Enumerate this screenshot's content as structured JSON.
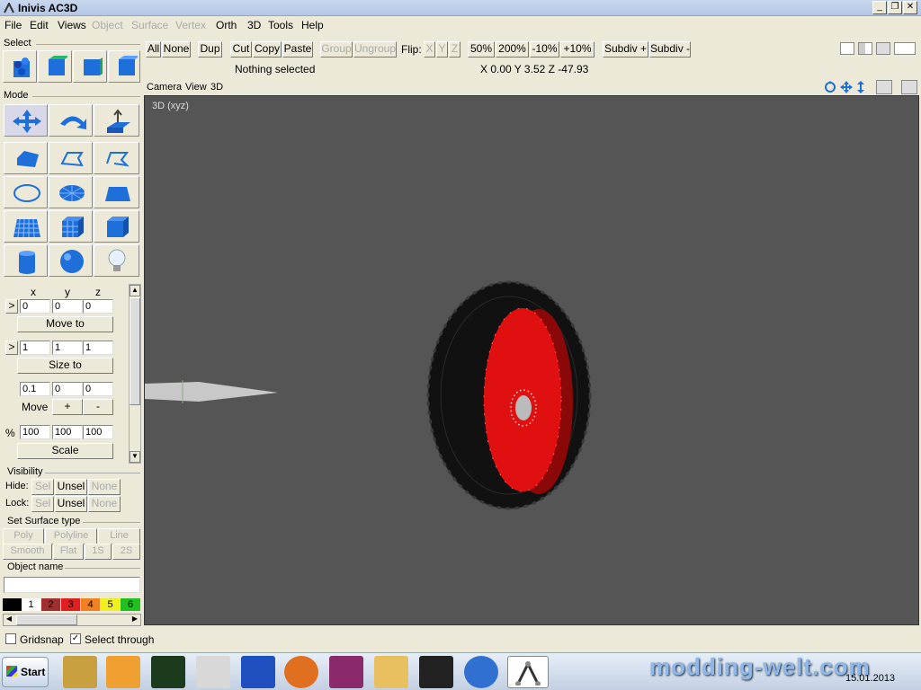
{
  "app": {
    "title": "Inivis AC3D"
  },
  "menu": [
    "File",
    "Edit",
    "Views",
    "Object",
    "Surface",
    "Vertex",
    "Orth",
    "3D",
    "Tools",
    "Help"
  ],
  "menu_disabled": [
    "Object",
    "Surface",
    "Vertex"
  ],
  "toolbar": {
    "all": "All",
    "none": "None",
    "dup": "Dup",
    "cut": "Cut",
    "copy": "Copy",
    "paste": "Paste",
    "group": "Group",
    "ungroup": "Ungroup",
    "flip_label": "Flip:",
    "flip_x": "X",
    "flip_y": "Y",
    "flip_z": "Z",
    "z50": "50%",
    "z200": "200%",
    "zm10": "-10%",
    "zp10": "+10%",
    "subdiv_plus": "Subdiv +",
    "subdiv_minus": "Subdiv -",
    "status": "Nothing selected",
    "coords": "X 0.00 Y 3.52 Z -47.93"
  },
  "panel": {
    "select_title": "Select",
    "mode_title": "Mode",
    "col_x": "x",
    "col_y": "y",
    "col_z": "z",
    "arrow": ">",
    "pos": {
      "x": "0",
      "y": "0",
      "z": "0"
    },
    "move_to": "Move to",
    "size": {
      "x": "1",
      "y": "1",
      "z": "1"
    },
    "size_to": "Size to",
    "step": {
      "x": "0.1",
      "y": "0",
      "z": "0"
    },
    "move": "Move",
    "plus": "+",
    "minus": "-",
    "pct": "%",
    "scale_vals": {
      "x": "100",
      "y": "100",
      "z": "100"
    },
    "scale": "Scale",
    "visibility_title": "Visibility",
    "hide": "Hide:",
    "lock": "Lock:",
    "sel": "Sel",
    "unsel": "Unsel",
    "none": "None",
    "surface_title": "Set Surface type",
    "poly": "Poly",
    "polyline": "Polyline",
    "line": "Line",
    "smooth": "Smooth",
    "flat": "Flat",
    "s1": "1S",
    "s2": "2S",
    "objname_title": "Object name",
    "objname_value": "",
    "swatches": [
      "1",
      "2",
      "3",
      "4",
      "5",
      "6"
    ]
  },
  "viewport": {
    "menu": [
      "Camera",
      "View",
      "3D"
    ],
    "label": "3D (xyz)"
  },
  "status": {
    "gridsnap": "Gridsnap",
    "select_through": "Select through"
  },
  "taskbar": {
    "start": "Start",
    "date": "15.01.2013"
  },
  "watermark": "modding-welt.com",
  "colors": {
    "wheel_rim": "#e01010",
    "tire": "#111111",
    "viewport_bg": "#555555"
  }
}
